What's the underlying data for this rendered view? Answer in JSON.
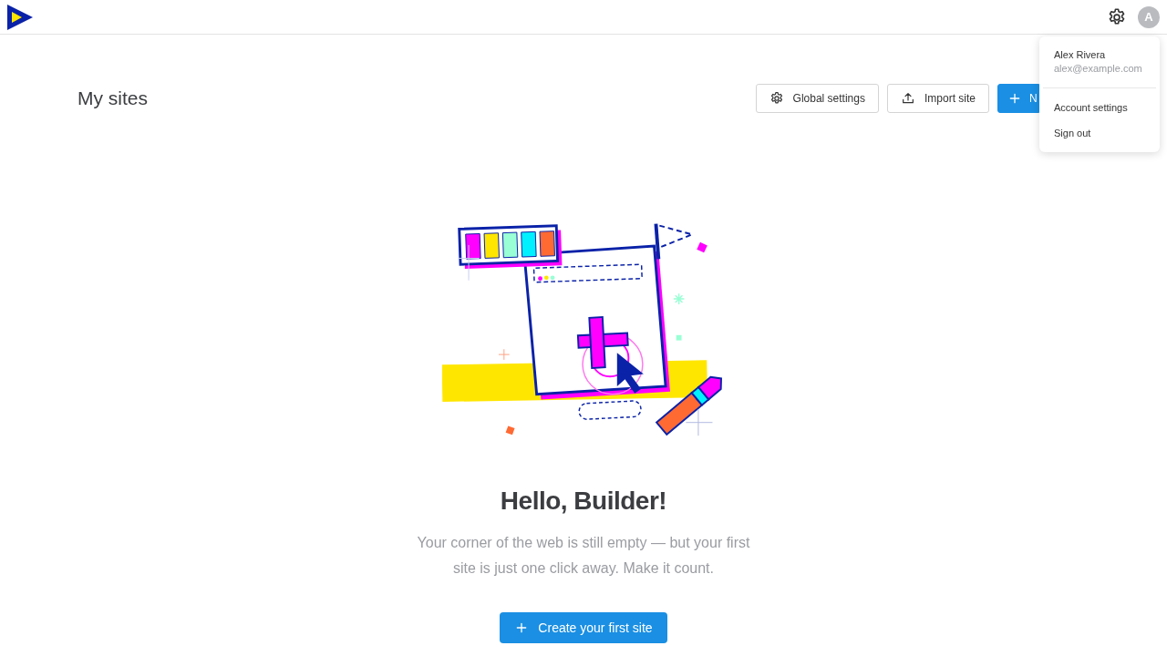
{
  "header": {
    "avatar_initial": "A"
  },
  "page": {
    "title": "My sites",
    "actions": [
      {
        "kind": "settings",
        "label": "Global settings"
      },
      {
        "kind": "import",
        "label": "Import site"
      },
      {
        "kind": "new",
        "label": "N"
      }
    ]
  },
  "empty_state": {
    "heading": "Hello, Builder!",
    "text": "Your corner of the web is still empty — but your first site is just one click away. Make it count.",
    "button": "Create your first site"
  },
  "user_menu": {
    "name": "Alex Rivera",
    "email": "alex@example.com",
    "items": [
      {
        "label": "Account settings"
      },
      {
        "label": "Sign out"
      }
    ]
  }
}
